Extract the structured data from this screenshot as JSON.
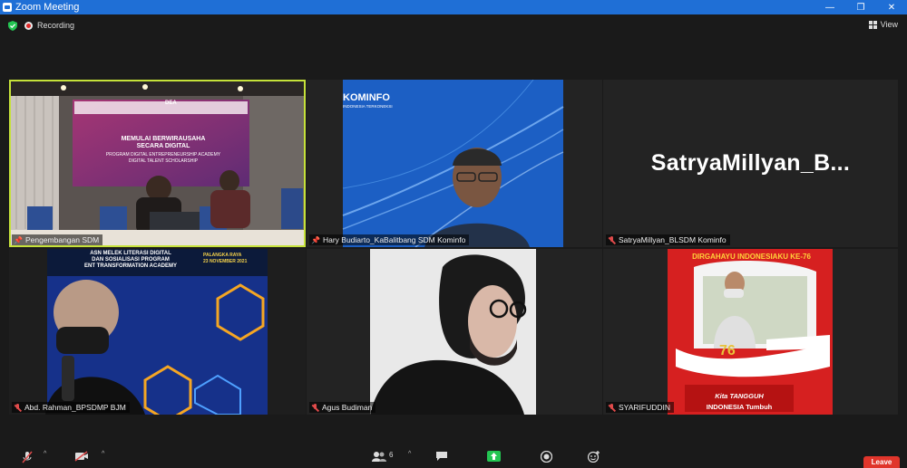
{
  "window": {
    "title": "Zoom Meeting"
  },
  "topbar": {
    "recording_label": "Recording",
    "view_label": "View"
  },
  "tiles": [
    {
      "name": "Pengembangan SDM",
      "muted": false,
      "active": true,
      "banner_lines": [
        "MEMULAI BERWIRAUSAHA",
        "SECARA DIGITAL",
        "PROGRAM DIGITAL ENTREPRENEURSHIP ACADEMY",
        "DIGITAL TALENT SCHOLARSHIP"
      ],
      "logo_text": "DEA"
    },
    {
      "name": "Hary Budiarto_KaBalitbang SDM Kominfo",
      "muted": false,
      "active": false,
      "bg_title": "KOMINFO",
      "bg_sub": "INDONESIA TERKONEKSI"
    },
    {
      "name": "SatryaMillyan_BLSDM Kominfo",
      "muted": true,
      "active": false,
      "display_name": "SatryaMillyan_B..."
    },
    {
      "name": "Abd. Rahman_BPSDMP BJM",
      "muted": true,
      "active": false,
      "bg_lines": [
        "ASN MELEK LITERASI DIGITAL",
        "DAN SOSIALISASI PROGRAM",
        "ENT TRANSFORMATION ACADEMY"
      ],
      "bg_location": "PALANGKA RAYA",
      "bg_date": "23 NOVEMBER 2021"
    },
    {
      "name": "Agus Budiman",
      "muted": true,
      "active": false
    },
    {
      "name": "SYARIFUDDIN",
      "muted": true,
      "active": false,
      "poster_top": "DIRGAHAYU INDONESIAKU KE-76",
      "poster_num": "76",
      "poster_bottom1": "Kita TANGGUH",
      "poster_bottom2": "INDONESIA Tumbuh"
    }
  ],
  "toolbar": {
    "participants_count": "6",
    "leave_label": "Leave"
  },
  "colors": {
    "active_border": "#c6e23a",
    "title_bar": "#1f6fd6",
    "leave": "#e0352b"
  }
}
